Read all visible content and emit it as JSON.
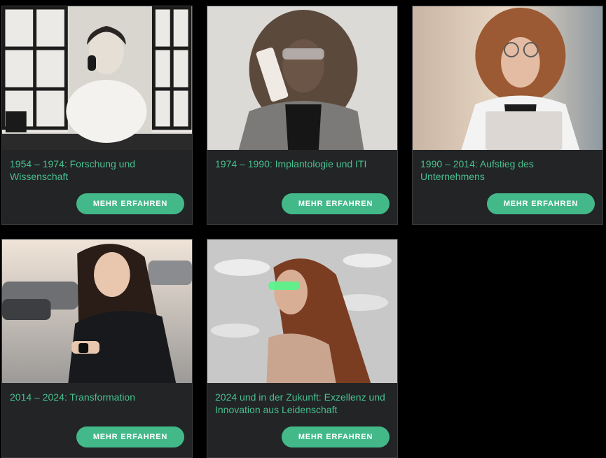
{
  "accent_color": "#43b98a",
  "title_color": "#49c08f",
  "cards": [
    {
      "title": "1954 – 1974: Forschung und Wissenschaft",
      "button_label": "MEHR ERFAHREN",
      "image": "woman-vintage-telephone-photo"
    },
    {
      "title": "1974 – 1990: Implantologie und ITI",
      "button_label": "MEHR ERFAHREN",
      "image": "woman-brick-phone-photo"
    },
    {
      "title": "1990 – 2014: Aufstieg des Unternehmens",
      "button_label": "MEHR ERFAHREN",
      "image": "woman-smartphone-laptop-photo"
    },
    {
      "title": "2014 – 2024: Transformation",
      "button_label": "MEHR ERFAHREN",
      "image": "woman-smartwatch-photo"
    },
    {
      "title": "2024 und in der Zukunft: Exzellenz und Innovation aus Leidenschaft",
      "button_label": "MEHR ERFAHREN",
      "image": "woman-futuristic-glasses-photo"
    }
  ]
}
